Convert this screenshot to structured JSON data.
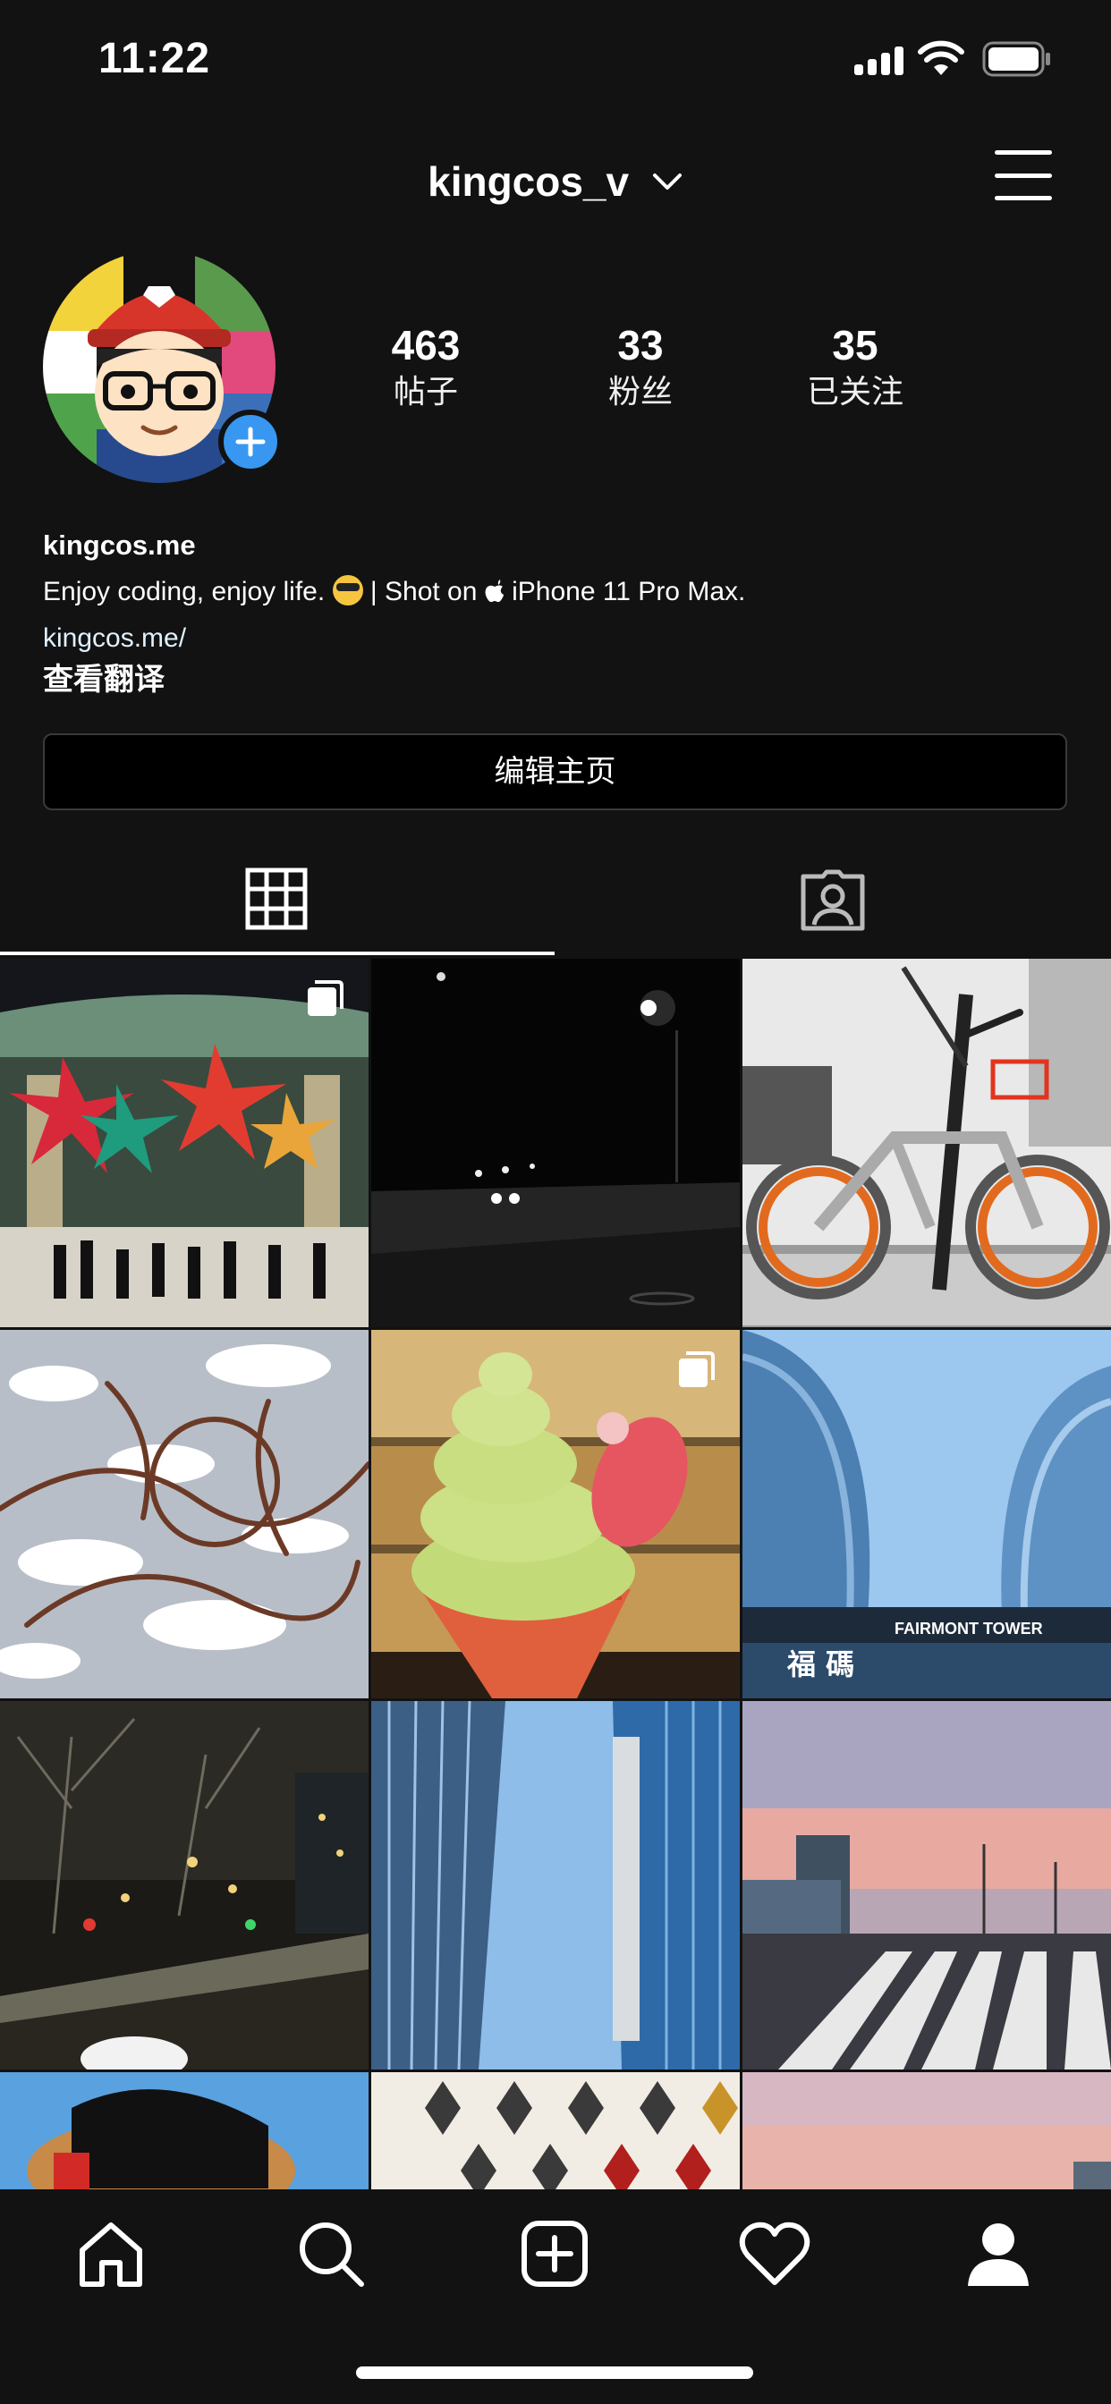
{
  "status_bar": {
    "time": "11:22"
  },
  "header": {
    "username": "kingcos_v"
  },
  "stats": [
    {
      "value": "463",
      "label": "帖子"
    },
    {
      "value": "33",
      "label": "粉丝"
    },
    {
      "value": "35",
      "label": "已关注"
    }
  ],
  "bio": {
    "name": "kingcos.me",
    "text_before_emoji": "Enjoy coding, enjoy life. ",
    "text_middle": " | Shot on ",
    "text_after_apple": " iPhone 11 Pro Max.",
    "link": "kingcos.me/",
    "translate": "查看翻译"
  },
  "edit_profile_label": "编辑主页",
  "tabs": [
    "grid-icon",
    "tagged-person-icon"
  ],
  "photo_text": {
    "tower_sign": "FAIRMONT TOWER",
    "tower_chars": "福 碼"
  },
  "bottom_nav": [
    "home-icon",
    "search-icon",
    "add-post-icon",
    "heart-icon",
    "profile-icon"
  ]
}
